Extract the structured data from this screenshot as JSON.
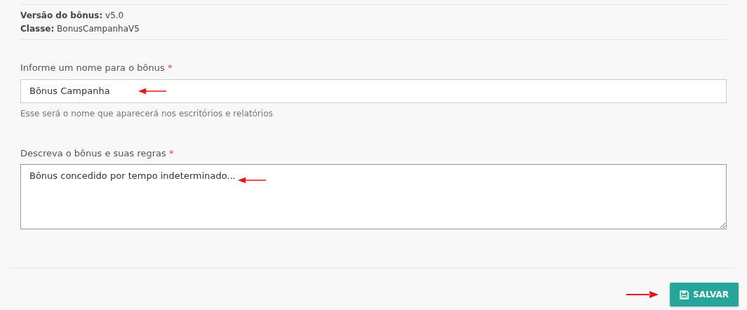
{
  "info": [
    {
      "label": "Versão do bônus:",
      "value": "v5.0"
    },
    {
      "label": "Classe:",
      "value": "BonusCampanhaV5"
    }
  ],
  "fields": [
    {
      "kind": "input",
      "label": "Informe um nome para o bônus",
      "required_mark": "*",
      "value": "Bônus Campanha",
      "help": "Esse será o nome que aparecerá nos escritórios e relatórios",
      "arrow": true
    },
    {
      "kind": "textarea",
      "label": "Descreva o bônus e suas regras",
      "required_mark": "*",
      "value": "Bônus concedido por tempo indeterminado...",
      "arrow": true
    }
  ],
  "save_button": {
    "label": "SALVAR",
    "arrow": true
  }
}
